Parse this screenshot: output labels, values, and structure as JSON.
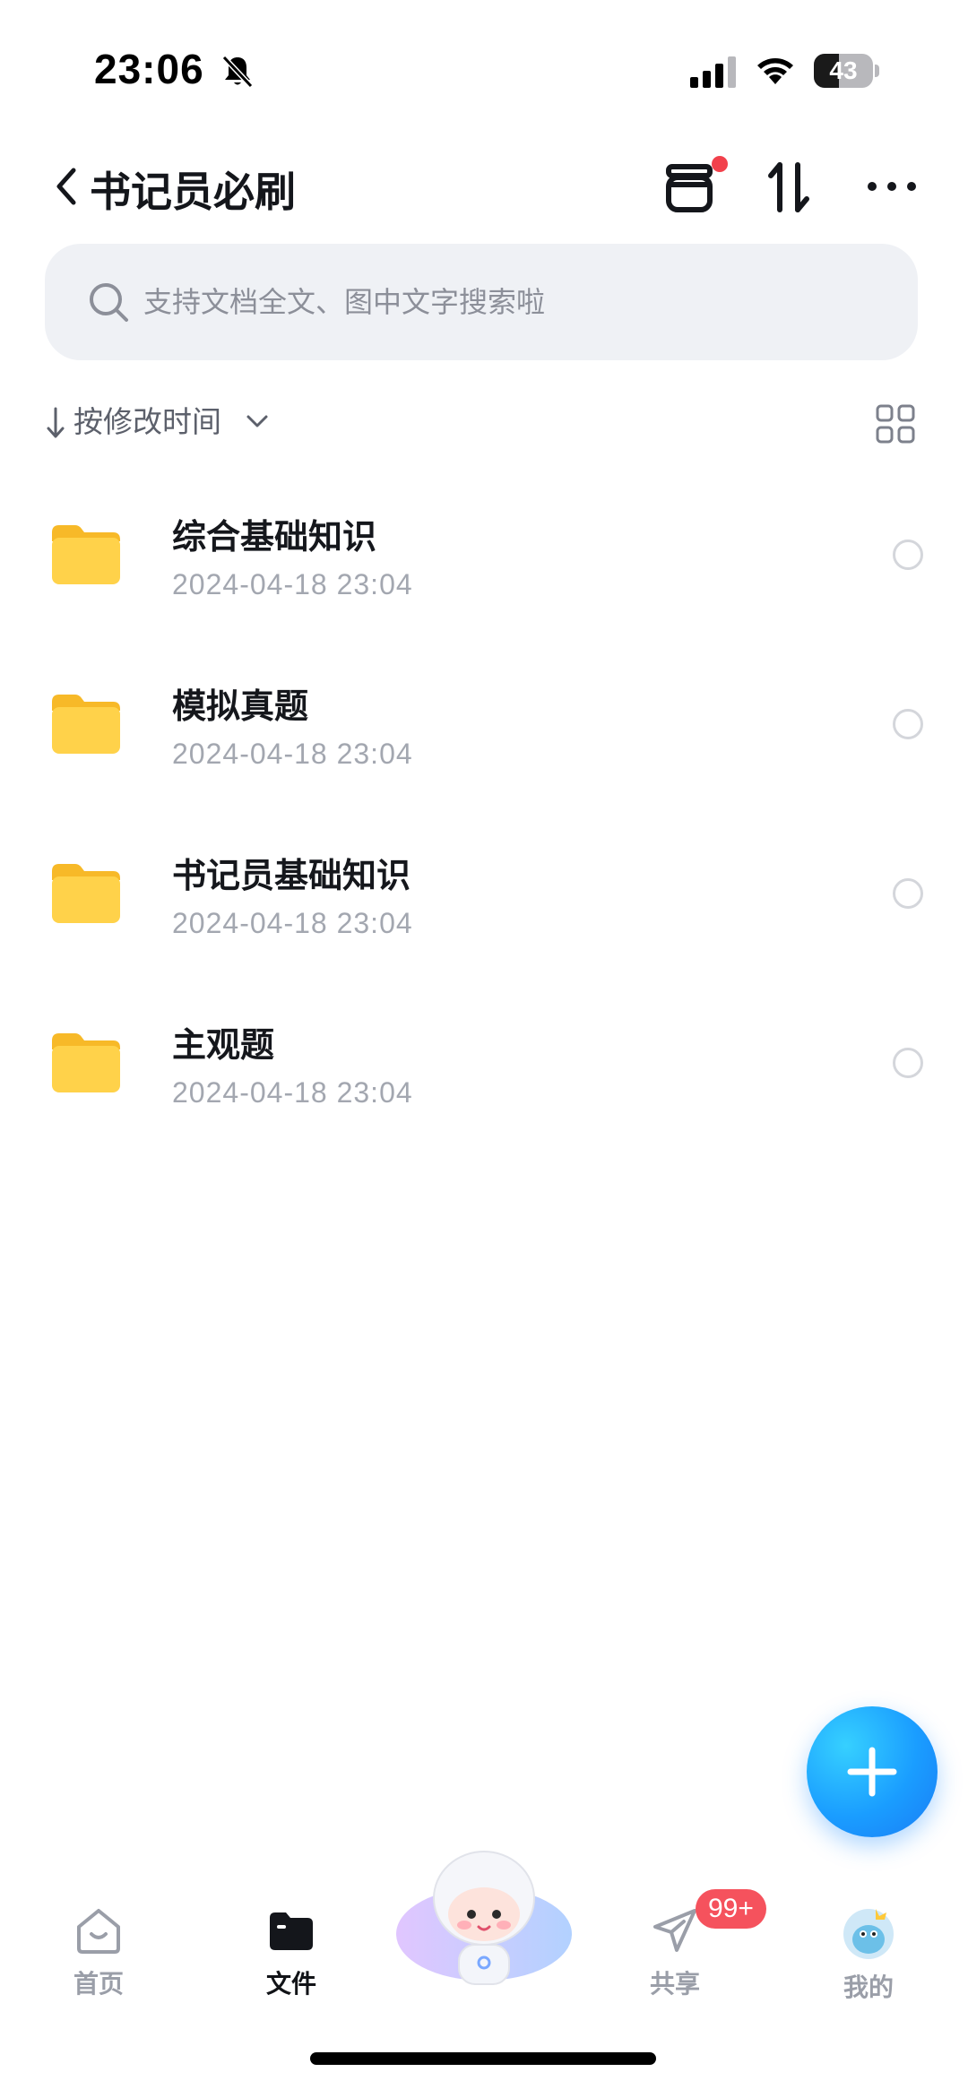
{
  "status_bar": {
    "time": "23:06",
    "battery": "43",
    "battery_level": 0.43
  },
  "header": {
    "title": "书记员必刷",
    "icons": [
      "chevron-left-icon",
      "box-icon",
      "sort-icon",
      "more-icon"
    ]
  },
  "search": {
    "placeholder": "支持文档全文、图中文字搜索啦"
  },
  "sort": {
    "label": "按修改时间"
  },
  "files": [
    {
      "name": "综合基础知识",
      "time": "2024-04-18 23:04"
    },
    {
      "name": "模拟真题",
      "time": "2024-04-18 23:04"
    },
    {
      "name": "书记员基础知识",
      "time": "2024-04-18 23:04"
    },
    {
      "name": "主观题",
      "time": "2024-04-18 23:04"
    }
  ],
  "tabs": [
    {
      "label": "首页"
    },
    {
      "label": "文件"
    },
    {
      "label": "共享",
      "badge": "99+"
    },
    {
      "label": "我的"
    }
  ],
  "colors": {
    "accent": "#1a9dff",
    "badge": "#f5525d",
    "folder": "#ffc93a"
  }
}
